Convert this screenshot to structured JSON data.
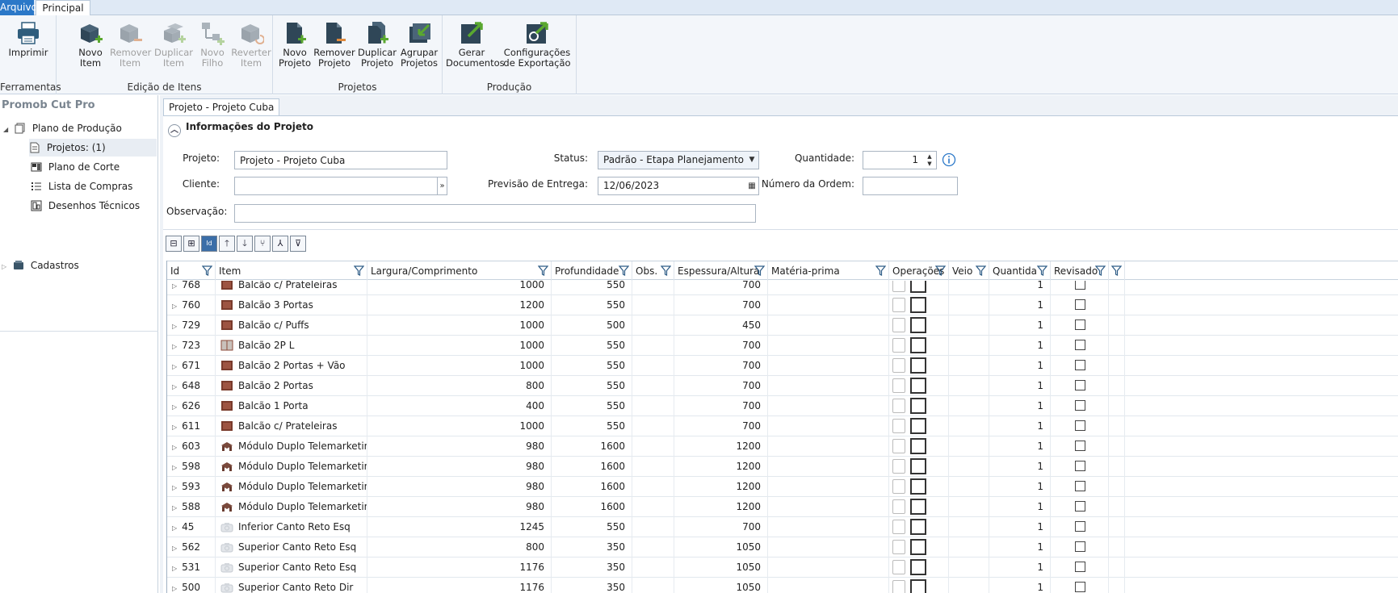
{
  "ribbon_tabs": [
    "Arquivo",
    "Principal"
  ],
  "ribbon": {
    "groups": [
      {
        "label": "Ferramentas",
        "buttons": [
          {
            "line1": "Imprimir",
            "line2": "",
            "enabled": true
          }
        ]
      },
      {
        "label": "Edição de Itens",
        "buttons": [
          {
            "line1": "Novo",
            "line2": "Item",
            "enabled": true
          },
          {
            "line1": "Remover",
            "line2": "Item",
            "enabled": false
          },
          {
            "line1": "Duplicar",
            "line2": "Item",
            "enabled": false
          },
          {
            "line1": "Novo",
            "line2": "Filho",
            "enabled": false
          },
          {
            "line1": "Reverter",
            "line2": "Item",
            "enabled": false
          }
        ]
      },
      {
        "label": "Projetos",
        "buttons": [
          {
            "line1": "Novo",
            "line2": "Projeto",
            "enabled": true
          },
          {
            "line1": "Remover",
            "line2": "Projeto",
            "enabled": true
          },
          {
            "line1": "Duplicar",
            "line2": "Projeto",
            "enabled": true
          },
          {
            "line1": "Agrupar",
            "line2": "Projetos",
            "enabled": true
          }
        ]
      },
      {
        "label": "Produção",
        "buttons": [
          {
            "line1": "Gerar",
            "line2": "Documentos",
            "enabled": true
          },
          {
            "line1": "Configurações",
            "line2": "de Exportação",
            "enabled": true
          }
        ]
      }
    ]
  },
  "tree": {
    "title": "Promob Cut Pro",
    "root": "Plano de Produção",
    "children": [
      "Projetos: (1)",
      "Plano de Corte",
      "Lista de Compras",
      "Desenhos Técnicos"
    ],
    "cadastros": "Cadastros"
  },
  "doc_tab": "Projeto - Projeto Cuba",
  "project_info": {
    "section_title": "Informações do Projeto",
    "projeto_label": "Projeto:",
    "projeto_value": "Projeto - Projeto Cuba",
    "cliente_label": "Cliente:",
    "cliente_value": "",
    "observacao_label": "Observação:",
    "observacao_value": "",
    "status_label": "Status:",
    "status_value": "Padrão - Etapa Planejamento",
    "previsao_label": "Previsão de Entrega:",
    "previsao_value": "12/06/2023",
    "quantidade_label": "Quantidade:",
    "quantidade_value": "1",
    "ordem_label": "Número da Ordem:",
    "ordem_value": ""
  },
  "grid": {
    "columns": [
      "Id",
      "Item",
      "Largura/Comprimento",
      "Profundidade",
      "Obs.",
      "Espessura/Altura",
      "Matéria-prima",
      "Operações",
      "Veio",
      "Quantida",
      "Revisado",
      ""
    ],
    "rows": [
      {
        "id": "768",
        "item": "Balcão c/ Prateleiras",
        "largura": "1000",
        "prof": "550",
        "esp": "700",
        "qtd": "1",
        "thumb": "cabinet"
      },
      {
        "id": "760",
        "item": "Balcão 3 Portas",
        "largura": "1200",
        "prof": "550",
        "esp": "700",
        "qtd": "1",
        "thumb": "cabinet"
      },
      {
        "id": "729",
        "item": "Balcão c/ Puffs",
        "largura": "1000",
        "prof": "500",
        "esp": "450",
        "qtd": "1",
        "thumb": "cabinet"
      },
      {
        "id": "723",
        "item": "Balcão 2P L",
        "largura": "1000",
        "prof": "550",
        "esp": "700",
        "qtd": "1",
        "thumb": "cabinet-light"
      },
      {
        "id": "671",
        "item": "Balcão 2 Portas + Vão",
        "largura": "1000",
        "prof": "550",
        "esp": "700",
        "qtd": "1",
        "thumb": "cabinet"
      },
      {
        "id": "648",
        "item": "Balcão 2 Portas",
        "largura": "800",
        "prof": "550",
        "esp": "700",
        "qtd": "1",
        "thumb": "cabinet"
      },
      {
        "id": "626",
        "item": "Balcão 1 Porta",
        "largura": "400",
        "prof": "550",
        "esp": "700",
        "qtd": "1",
        "thumb": "cabinet"
      },
      {
        "id": "611",
        "item": "Balcão c/ Prateleiras",
        "largura": "1000",
        "prof": "550",
        "esp": "700",
        "qtd": "1",
        "thumb": "cabinet"
      },
      {
        "id": "603",
        "item": "Módulo Duplo Telemarketing",
        "largura": "980",
        "prof": "1600",
        "esp": "1200",
        "qtd": "1",
        "thumb": "desk"
      },
      {
        "id": "598",
        "item": "Módulo Duplo Telemarketing",
        "largura": "980",
        "prof": "1600",
        "esp": "1200",
        "qtd": "1",
        "thumb": "desk"
      },
      {
        "id": "593",
        "item": "Módulo Duplo Telemarketing",
        "largura": "980",
        "prof": "1600",
        "esp": "1200",
        "qtd": "1",
        "thumb": "desk"
      },
      {
        "id": "588",
        "item": "Módulo Duplo Telemarketing",
        "largura": "980",
        "prof": "1600",
        "esp": "1200",
        "qtd": "1",
        "thumb": "desk"
      },
      {
        "id": "45",
        "item": "Inferior Canto Reto Esq",
        "largura": "1245",
        "prof": "550",
        "esp": "700",
        "qtd": "1",
        "thumb": "camera"
      },
      {
        "id": "562",
        "item": "Superior Canto Reto Esq",
        "largura": "800",
        "prof": "350",
        "esp": "1050",
        "qtd": "1",
        "thumb": "camera"
      },
      {
        "id": "531",
        "item": "Superior Canto Reto Esq",
        "largura": "1176",
        "prof": "350",
        "esp": "1050",
        "qtd": "1",
        "thumb": "camera"
      },
      {
        "id": "500",
        "item": "Superior Canto Reto Dir",
        "largura": "1176",
        "prof": "350",
        "esp": "1050",
        "qtd": "1",
        "thumb": "camera"
      }
    ]
  }
}
